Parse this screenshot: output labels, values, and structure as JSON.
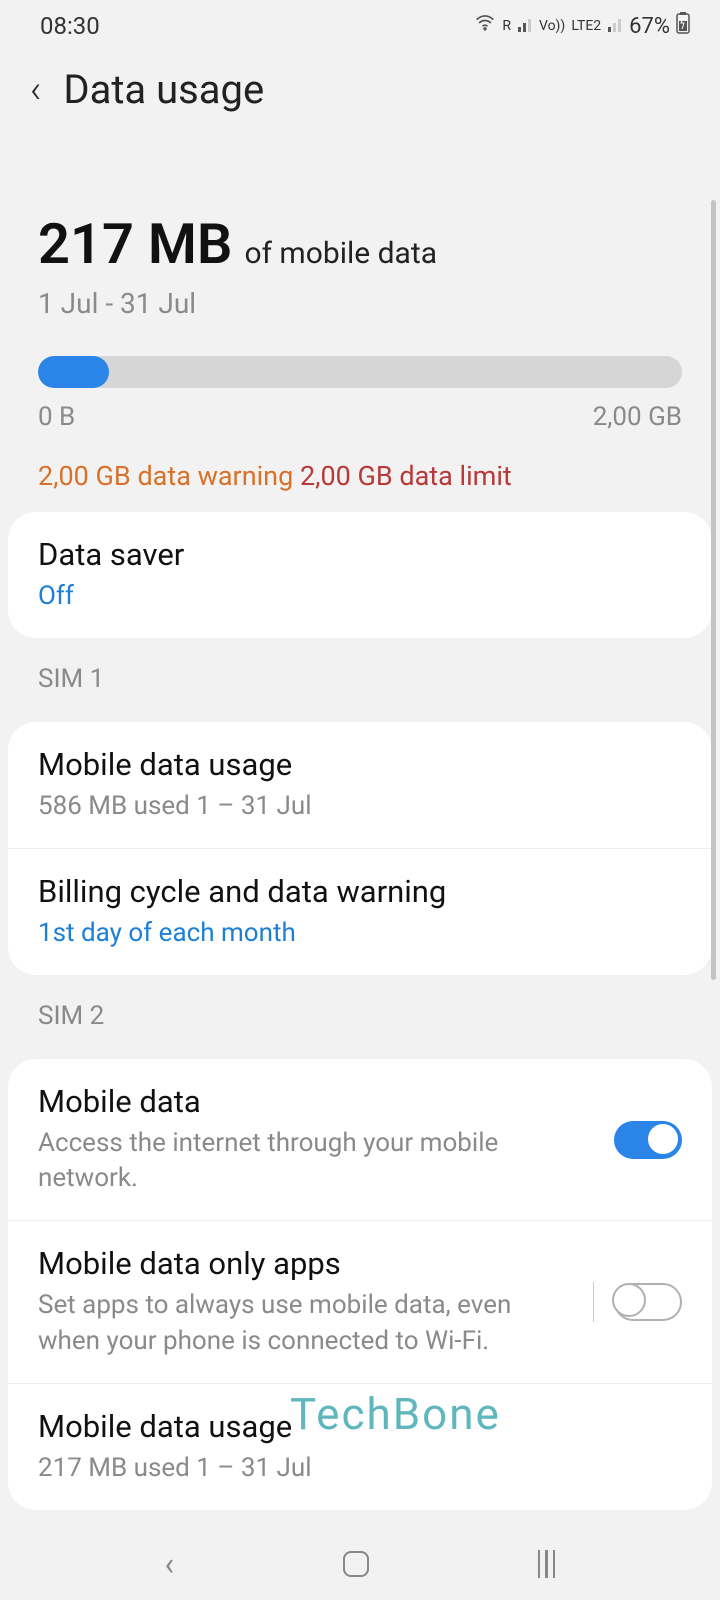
{
  "status": {
    "time": "08:30",
    "network1": "R",
    "network2": "LTE2",
    "volte": "Vo))",
    "battery": "67%"
  },
  "header": {
    "title": "Data usage"
  },
  "summary": {
    "amount": "217 MB",
    "label": "of mobile data",
    "period": "1 Jul - 31 Jul",
    "min_label": "0 B",
    "max_label": "2,00 GB",
    "warning": "2,00 GB data warning",
    "limit": "2,00 GB data limit"
  },
  "data_saver": {
    "title": "Data saver",
    "status": "Off"
  },
  "sim1": {
    "label": "SIM 1",
    "mobile_usage": {
      "title": "Mobile data usage",
      "sub": "586 MB used 1 – 31 Jul"
    },
    "billing": {
      "title": "Billing cycle and data warning",
      "sub": "1st day of each month"
    }
  },
  "sim2": {
    "label": "SIM 2",
    "mobile_data": {
      "title": "Mobile data",
      "sub": "Access the internet through your mobile network."
    },
    "only_apps": {
      "title": "Mobile data only apps",
      "sub": "Set apps to always use mobile data, even when your phone is connected to Wi-Fi."
    },
    "mobile_usage": {
      "title": "Mobile data usage",
      "sub": "217 MB used 1 – 31 Jul"
    }
  },
  "watermark": "TechBone"
}
